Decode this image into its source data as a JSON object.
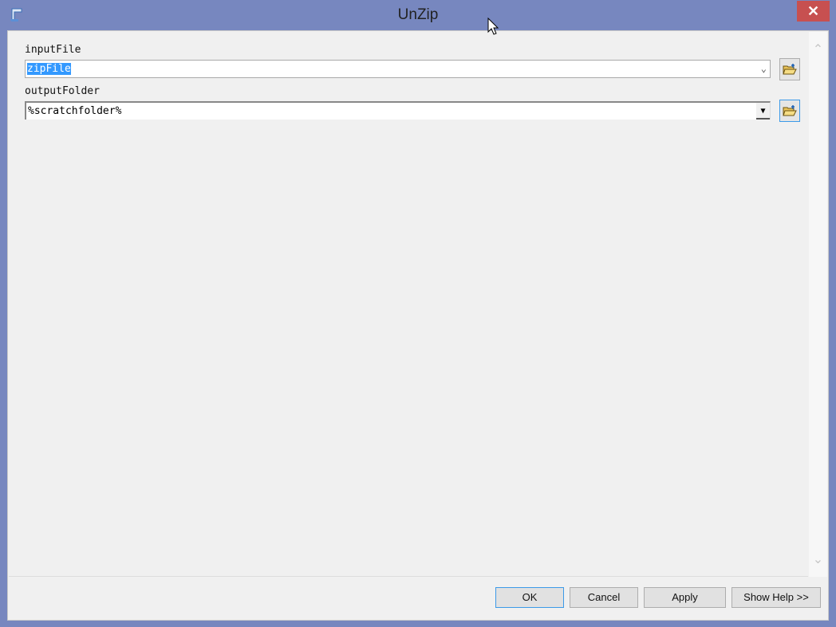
{
  "window": {
    "title": "UnZip",
    "close_label": "✕"
  },
  "form": {
    "input_file": {
      "label": "inputFile",
      "value": "zipFile"
    },
    "output_folder": {
      "label": "outputFolder",
      "value": "%scratchfolder%"
    }
  },
  "buttons": {
    "ok": "OK",
    "cancel": "Cancel",
    "apply": "Apply",
    "show_help": "Show Help >>"
  },
  "colors": {
    "frame": "#7787bf",
    "close": "#c75050",
    "selection": "#3399ff",
    "focus": "#3c9ae8"
  }
}
